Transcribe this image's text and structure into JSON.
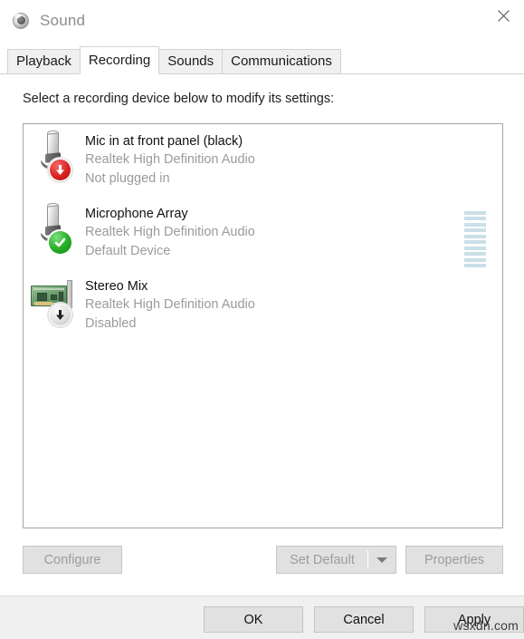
{
  "window": {
    "title": "Sound",
    "icon": "speaker-icon",
    "close_label": "✕"
  },
  "tabs": [
    {
      "label": "Playback",
      "active": false
    },
    {
      "label": "Recording",
      "active": true
    },
    {
      "label": "Sounds",
      "active": false
    },
    {
      "label": "Communications",
      "active": false
    }
  ],
  "instruction": "Select a recording device below to modify its settings:",
  "devices": [
    {
      "name": "Mic in at front panel (black)",
      "driver": "Realtek High Definition Audio",
      "status": "Not plugged in",
      "icon": "audio-jack-icon",
      "badge": "red-down-arrow-icon",
      "meter": false
    },
    {
      "name": "Microphone Array",
      "driver": "Realtek High Definition Audio",
      "status": "Default Device",
      "icon": "audio-jack-icon",
      "badge": "green-check-icon",
      "meter": true,
      "meter_segments": 10,
      "meter_level": 0
    },
    {
      "name": "Stereo Mix",
      "driver": "Realtek High Definition Audio",
      "status": "Disabled",
      "icon": "sound-card-icon",
      "badge": "gray-down-arrow-icon",
      "meter": false
    }
  ],
  "actions": {
    "configure": "Configure",
    "set_default": "Set Default",
    "set_default_arrow": "chevron-down-icon",
    "properties": "Properties"
  },
  "footer": {
    "ok": "OK",
    "cancel": "Cancel",
    "apply": "Apply"
  },
  "watermark": "wsxdn.com",
  "colors": {
    "accent_green": "#26af26",
    "accent_red": "#d92121",
    "meter_segment": "#cadfe8",
    "dialog_bg": "#ffffff",
    "footer_bg": "#f0f0f0",
    "muted_text": "#9b9b9b"
  }
}
